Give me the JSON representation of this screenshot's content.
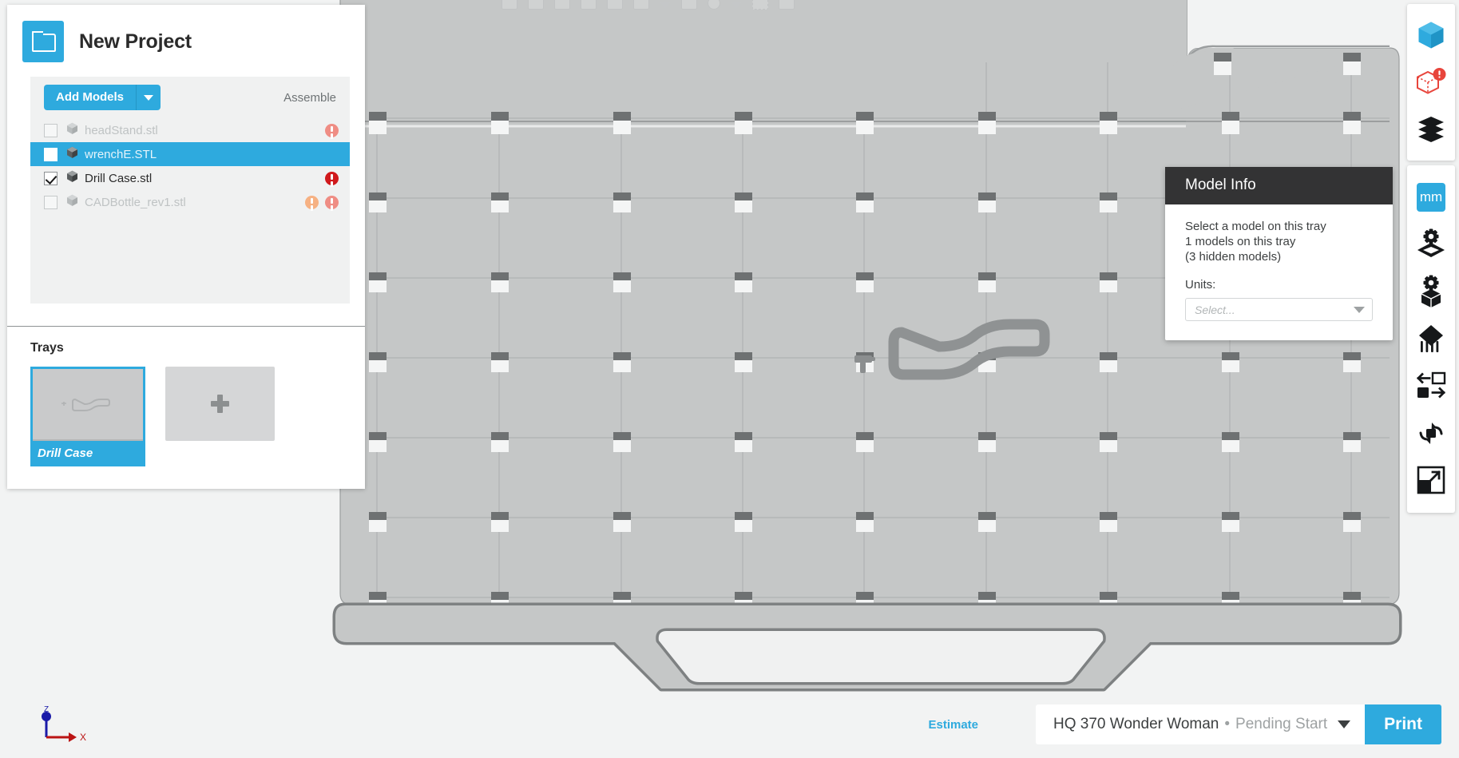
{
  "app": {
    "project_title": "New Project"
  },
  "models_panel": {
    "add_models_label": "Add Models",
    "assemble_label": "Assemble",
    "rows": [
      {
        "name": "headStand.stl",
        "checked": false,
        "enabled": false,
        "selected": false,
        "badges": [
          "red-soft"
        ]
      },
      {
        "name": "wrenchE.STL",
        "checked": false,
        "enabled": true,
        "selected": true,
        "badges": []
      },
      {
        "name": "Drill Case.stl",
        "checked": true,
        "enabled": true,
        "selected": false,
        "badges": [
          "red-strong"
        ]
      },
      {
        "name": "CADBottle_rev1.stl",
        "checked": false,
        "enabled": false,
        "selected": false,
        "badges": [
          "orange",
          "red-soft"
        ]
      }
    ]
  },
  "trays": {
    "title": "Trays",
    "items": [
      {
        "caption": "Drill Case",
        "selected": true
      }
    ],
    "add_tray_label": "+"
  },
  "model_info": {
    "title": "Model Info",
    "line1": "Select a model on this tray",
    "line2": "1 models on this tray",
    "line3": "(3 hidden models)",
    "units_label": "Units:",
    "units_placeholder": "Select..."
  },
  "right_rail_top": [
    {
      "icon": "solid-cube-icon",
      "name": "view-solid-button"
    },
    {
      "icon": "wireframe-cube-alert-icon",
      "name": "view-wireframe-button"
    },
    {
      "icon": "layers-icon",
      "name": "view-layers-button"
    }
  ],
  "right_rail_bottom": [
    {
      "icon": "mm-units-icon",
      "name": "units-mm-button",
      "label": "mm"
    },
    {
      "icon": "gear-diamond-icon",
      "name": "tray-settings-button"
    },
    {
      "icon": "gear-cube-icon",
      "name": "model-settings-button"
    },
    {
      "icon": "supports-icon",
      "name": "supports-button"
    },
    {
      "icon": "swap-icon",
      "name": "swap-button"
    },
    {
      "icon": "rotate-icon",
      "name": "rotate-button"
    },
    {
      "icon": "scale-icon",
      "name": "scale-button"
    }
  ],
  "axis_widget": {
    "z_label": "Z",
    "x_label": "X",
    "z_color": "#1a1aa8",
    "x_color": "#bb1414"
  },
  "bottom_bar": {
    "estimate_label": "Estimate",
    "printer_name": "HQ 370 Wonder Woman",
    "printer_separator": "•",
    "printer_status": "Pending Start",
    "print_label": "Print"
  },
  "colors": {
    "accent": "#2eaade",
    "panel_bg": "#f0f1f1",
    "viewport_bg": "#f2f3f3",
    "tray_surface": "#c5c7c7",
    "popup_header": "#333334",
    "warning_strong": "#d0191c",
    "warning_soft": "#ef8d84",
    "warning_orange": "#f6b183"
  }
}
